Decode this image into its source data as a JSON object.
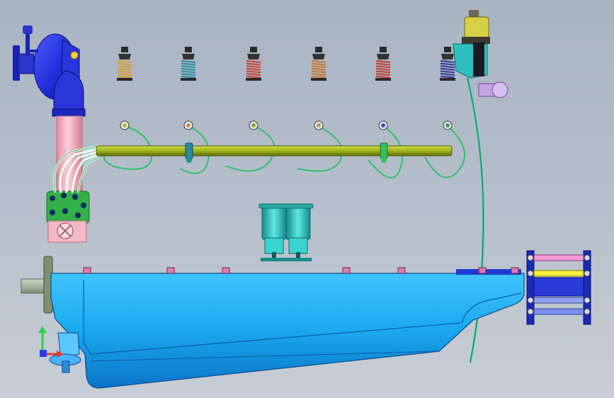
{
  "viewport": {
    "background_top": "#a9b4c3",
    "background_bottom": "#c8ced6"
  },
  "colors": {
    "pump_blue": "#2230d8",
    "pipe_pink": "#f2a9b8",
    "rail_olive": "#a6b81a",
    "fuel_line_green": "#34c277",
    "sump_cyan": "#1fb2f0",
    "filter_teal": "#25c9c6",
    "solenoid_gold": "#c9c23a",
    "valve_lilac": "#c7a3e6",
    "axis_x": "#e23a2a",
    "axis_y": "#2bd14a",
    "axis_z": "#2a3ae6"
  },
  "springs": [
    {
      "name": "spring-1",
      "color": "#d4a23a"
    },
    {
      "name": "spring-2",
      "color": "#2f8fa0"
    },
    {
      "name": "spring-3",
      "color": "#c24a3a"
    },
    {
      "name": "spring-4",
      "color": "#c77a3a"
    },
    {
      "name": "spring-5",
      "color": "#c0443a"
    },
    {
      "name": "spring-6",
      "color": "#3a3e9a"
    }
  ],
  "injector_ports": [
    {
      "name": "port-1",
      "color": "#c9b03a"
    },
    {
      "name": "port-2",
      "color": "#d08a3a"
    },
    {
      "name": "port-3",
      "color": "#9aa03a"
    },
    {
      "name": "port-4",
      "color": "#b0a060"
    },
    {
      "name": "port-5",
      "color": "#3a48c2"
    },
    {
      "name": "port-6",
      "color": "#3aa050"
    }
  ]
}
